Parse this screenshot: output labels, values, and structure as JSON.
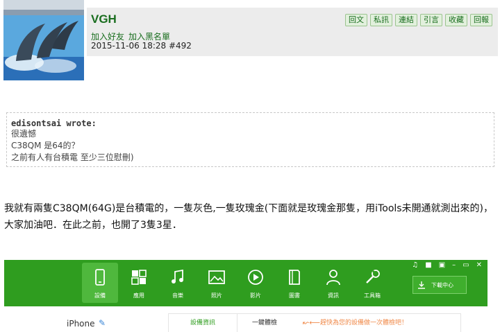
{
  "post": {
    "username": "VGH",
    "add_friend": "加入好友",
    "add_blacklist": "加入黑名單",
    "datetime": "2015-11-06 18:28",
    "post_number": "#492",
    "actions": [
      "回文",
      "私訊",
      "連結",
      "引言",
      "收藏",
      "回報"
    ]
  },
  "quote": {
    "author": "edisontsai wrote:",
    "lines": [
      "很遺憾",
      "C38QM 是64的？",
      "之前有人有台積電 至少三位慰刪)"
    ]
  },
  "body": {
    "text": "我就有兩隻C38QM(64G)是台積電的，一隻灰色,一隻玫瑰金(下面就是玫瑰金那隻，用iTools未開通就測出來的)，大家加油吧．在此之前，也開了3隻3星．"
  },
  "itools": {
    "tabs": [
      {
        "label": "設備",
        "icon": "phone-icon",
        "active": true
      },
      {
        "label": "應用",
        "icon": "apps-icon",
        "active": false
      },
      {
        "label": "音樂",
        "icon": "music-icon",
        "active": false
      },
      {
        "label": "照片",
        "icon": "photo-icon",
        "active": false
      },
      {
        "label": "影片",
        "icon": "video-icon",
        "active": false
      },
      {
        "label": "圖書",
        "icon": "book-icon",
        "active": false
      },
      {
        "label": "資訊",
        "icon": "person-icon",
        "active": false
      },
      {
        "label": "工具箱",
        "icon": "tools-icon",
        "active": false
      }
    ],
    "download_center": "下載中心",
    "device_name": "iPhone",
    "tab_device_info": "設備資訊",
    "tab_one_click_check": "一鍵體檢",
    "check_prompt": "趕快為您的設備做一次體檢吧！",
    "colors": {
      "bar": "#2f9d1f",
      "accent": "#f08a4a"
    }
  }
}
